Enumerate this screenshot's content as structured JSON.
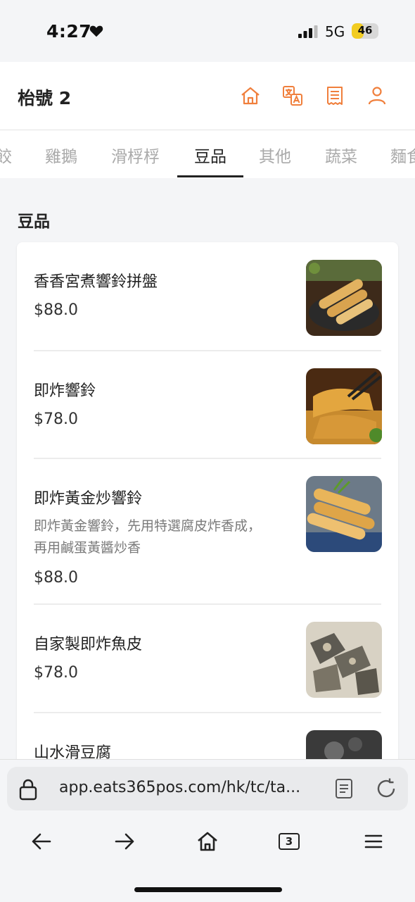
{
  "status_bar": {
    "time": "4:27",
    "network": "5G",
    "battery": "46",
    "battery_level": 0.46
  },
  "header": {
    "title": "枱號 2",
    "icons": [
      "home-icon",
      "translate-icon",
      "receipt-icon",
      "user-icon"
    ],
    "accent_color": "#f07f3c"
  },
  "categories": {
    "tabs": [
      "餃",
      "雞鵝",
      "滑桴桴",
      "豆品",
      "其他",
      "蔬菜",
      "麵食"
    ],
    "active": "豆品"
  },
  "section": {
    "title": "豆品"
  },
  "items": [
    {
      "name": "香香宮煮響鈴拼盤",
      "price": "$88.0"
    },
    {
      "name": "即炸響鈴",
      "price": "$78.0"
    },
    {
      "name": "即炸黃金炒響鈴",
      "description_line1": "即炸黃金響鈴，先用特選腐皮炸香成，",
      "description_line2": "再用鹹蛋黃醬炒香",
      "price": "$88.0"
    },
    {
      "name": "自家製即炸魚皮",
      "price": "$78.0"
    },
    {
      "name": "山水滑豆腐"
    }
  ],
  "browser": {
    "url": "app.eats365pos.com/hk/tc/ta...",
    "tab_count": "3",
    "icons": [
      "lock-icon",
      "reader-icon",
      "reload-icon",
      "back-icon",
      "forward-icon",
      "home-icon",
      "tabs-icon",
      "menu-icon"
    ]
  }
}
